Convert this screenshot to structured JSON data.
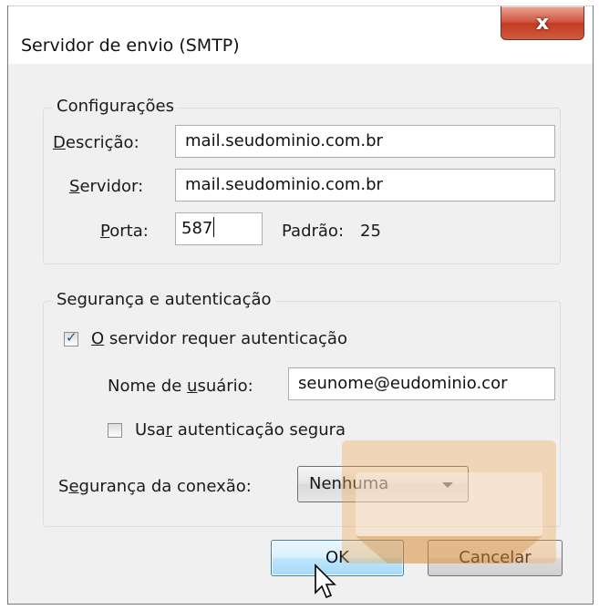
{
  "dialog": {
    "title": "Servidor de envio (SMTP)",
    "close_glyph": "x"
  },
  "config": {
    "legend": "Configurações",
    "descricao": {
      "label_u": "D",
      "label_rest": "escrição:",
      "value": "mail.seudominio.com.br"
    },
    "servidor": {
      "label_u": "S",
      "label_rest": "ervidor:",
      "value": "mail.seudominio.com.br"
    },
    "porta": {
      "label_u": "P",
      "label_rest": "orta:",
      "value": "587",
      "default_label": "Padrão:",
      "default_value": "25"
    }
  },
  "security": {
    "legend": "Segurança e autenticação",
    "requires_auth": {
      "checked": true,
      "label_u": "O",
      "label_rest": " servidor requer autenticação"
    },
    "username": {
      "label_pre": "Nome de ",
      "label_u": "u",
      "label_rest": "suário:",
      "value": "seunome@eudominio.cor"
    },
    "secure_auth": {
      "checked": false,
      "label_pre": "Usa",
      "label_u": "r",
      "label_rest": " autenticação segura"
    },
    "connection": {
      "label_pre": "S",
      "label_u": "e",
      "label_rest": "gurança da conexão:",
      "selected": "Nenhuma"
    }
  },
  "buttons": {
    "ok": "OK",
    "cancel": "Cancelar"
  },
  "colors": {
    "close_red": "#c23b22",
    "watermark_orange": "#f2a64a",
    "ok_blue": "#3c7fb1"
  }
}
